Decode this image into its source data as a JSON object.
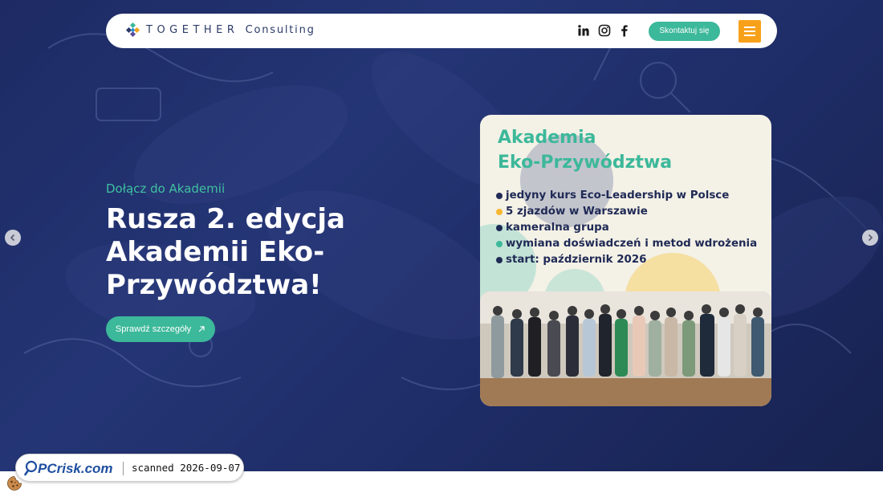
{
  "brand": {
    "name_part1": "TOGETHER",
    "name_part2": "Consulting",
    "colors": {
      "navy": "#243575",
      "teal": "#3cb89a",
      "orange": "#f7a11a"
    }
  },
  "nav": {
    "social_icons": [
      "linkedin-icon",
      "instagram-icon",
      "facebook-icon"
    ],
    "contact_label": "Skontaktuj się",
    "menu_icon": "hamburger-icon"
  },
  "hero": {
    "eyebrow": "Dołącz do Akademii",
    "headline_line1": "Rusza 2. edycja",
    "headline_line2": "Akademii Eko-",
    "headline_line3": "Przywództwa!",
    "cta_label": "Sprawdź szczegóły",
    "cta_icon": "arrow-up-right-icon",
    "prev_icon": "chevron-left-icon",
    "next_icon": "chevron-right-icon"
  },
  "card": {
    "title_line1": "Akademia",
    "title_line2": "Eko-Przywództwa",
    "bullets": [
      {
        "text": "jedyny kurs Eco-Leadership w Polsce",
        "color": "#1f2a55"
      },
      {
        "text": "5 zjazdów w Warszawie",
        "color": "#f7b733"
      },
      {
        "text": "kameralna grupa",
        "color": "#1f2a55"
      },
      {
        "text": "wymiana doświadczeń i metod wdrożenia",
        "color": "#3cb89a"
      },
      {
        "text": "start: październik 2026",
        "color": "#1f2a55"
      }
    ]
  },
  "badge": {
    "logo_text": "PCrisk.com",
    "scan_text": "scanned 2026-09-07"
  },
  "cookie_icon": "cookie-icon"
}
